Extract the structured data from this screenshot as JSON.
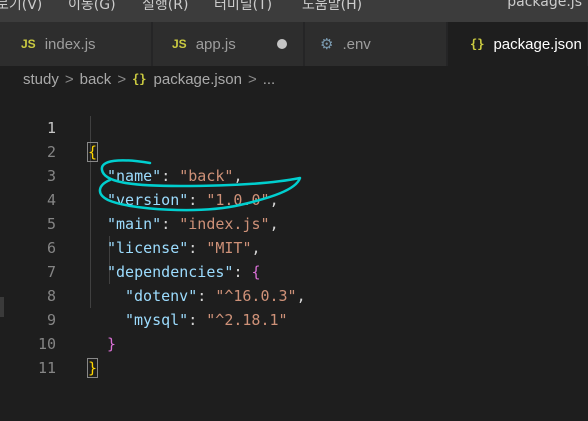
{
  "menubar": {
    "items": [
      "로기(V)",
      "이동(G)",
      "실행(R)",
      "터미널(T)",
      "도움말(H)"
    ],
    "window_title": "package.js"
  },
  "tabs": [
    {
      "label": "index.js",
      "icon": "js-icon",
      "icon_text": "JS"
    },
    {
      "label": "app.js",
      "icon": "js-icon",
      "icon_text": "JS",
      "modified": true
    },
    {
      "label": ".env",
      "icon": "gear-icon",
      "icon_text": "⚙"
    },
    {
      "label": "package.json",
      "icon": "json-icon",
      "icon_text": "{}",
      "active": true
    }
  ],
  "breadcrumb": {
    "items": [
      "study",
      "back",
      "package.json",
      "..."
    ],
    "separator": ">",
    "json_icon_text": "{}"
  },
  "editor": {
    "line_numbers": [
      "1",
      "2",
      "3",
      "4",
      "5",
      "6",
      "7",
      "8",
      "9",
      "10",
      "11"
    ],
    "active_line": 1,
    "code": {
      "l2_key": "\"name\"",
      "l2_val": "\"back\"",
      "l3_key": "\"version\"",
      "l3_val": "\"1.0.0\"",
      "l4_key": "\"main\"",
      "l4_val": "\"index.js\"",
      "l5_key": "\"license\"",
      "l5_val": "\"MIT\"",
      "l6_key": "\"dependencies\"",
      "l7_key": "\"dotenv\"",
      "l7_val": "\"^16.0.3\"",
      "l8_key": "\"mysql\"",
      "l8_val": "\"^2.18.1\"",
      "open_brace": "{",
      "close_brace": "}",
      "colon": ": ",
      "comma": ","
    }
  },
  "colors": {
    "key": "#9cdcfe",
    "string": "#ce9178",
    "bracket_level1": "#ffd700",
    "bracket_level2": "#da70d6",
    "annotation": "#00d0d0"
  }
}
